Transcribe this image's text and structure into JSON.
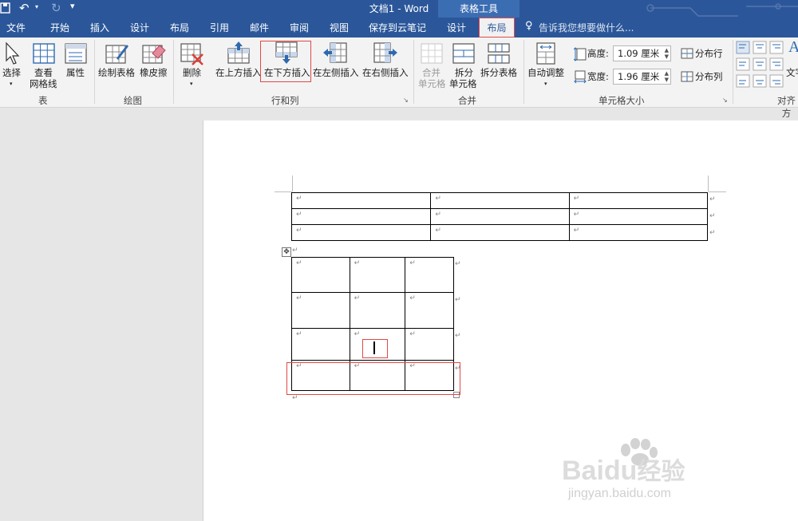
{
  "window": {
    "title": "文档1 - Word",
    "context_tools_label": "表格工具"
  },
  "tabs": [
    "文件",
    "开始",
    "插入",
    "设计",
    "布局",
    "引用",
    "邮件",
    "审阅",
    "视图",
    "保存到云笔记"
  ],
  "context_tabs": {
    "design": "设计",
    "layout": "布局"
  },
  "tell_me": {
    "placeholder": "告诉我您想要做什么..."
  },
  "ribbon": {
    "groups": {
      "table": {
        "label": "表",
        "select": "选择",
        "view_grid_line1": "查看",
        "view_grid_line2": "网格线",
        "properties": "属性"
      },
      "draw": {
        "label": "绘图",
        "draw_table": "绘制表格",
        "eraser": "橡皮擦"
      },
      "rows_cols": {
        "label": "行和列",
        "delete": "删除",
        "insert_above": "在上方插入",
        "insert_below": "在下方插入",
        "insert_left": "在左侧插入",
        "insert_right": "在右侧插入"
      },
      "merge": {
        "label": "合并",
        "merge_line1": "合并",
        "merge_line2": "单元格",
        "split_line1": "拆分",
        "split_line2": "单元格",
        "split_table": "拆分表格"
      },
      "cell_size": {
        "label": "单元格大小",
        "autofit": "自动调整",
        "height_label": "高度:",
        "height_value": "1.09 厘米",
        "width_label": "宽度:",
        "width_value": "1.96 厘米",
        "distribute_rows": "分布行",
        "distribute_cols": "分布列"
      },
      "align": {
        "label": "对齐方",
        "text_direction": "文字"
      }
    }
  },
  "document": {
    "paragraph_mark": "↵"
  },
  "watermark": {
    "brand": "Baidu",
    "brand_cn": "经验",
    "url": "jingyan.baidu.com"
  },
  "colors": {
    "title_blue": "#2b579a",
    "highlight_red": "#e34848"
  }
}
